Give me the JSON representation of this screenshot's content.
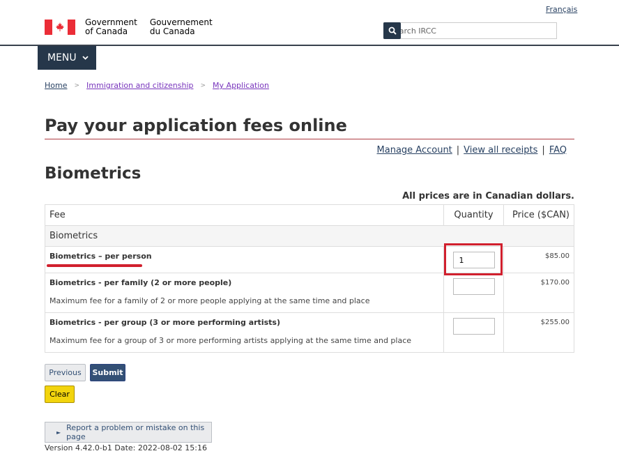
{
  "header": {
    "lang_toggle": "Français",
    "brand_en_line1": "Government",
    "brand_en_line2": "of Canada",
    "brand_fr_line1": "Gouvernement",
    "brand_fr_line2": "du Canada",
    "search_placeholder": "Search IRCC",
    "menu_label": "MENU",
    "colors": {
      "flag_red": "#eb2d37",
      "nav_dark": "#26374a"
    }
  },
  "breadcrumb": [
    "Home",
    "Immigration and citizenship",
    "My Application"
  ],
  "page_title": "Pay your application fees online",
  "account_links": {
    "manage": "Manage Account",
    "receipts": "View all receipts",
    "faq": "FAQ"
  },
  "section_title": "Biometrics",
  "prices_note": "All prices are in Canadian dollars.",
  "table": {
    "headers": {
      "fee": "Fee",
      "quantity": "Quantity",
      "price": "Price ($CAN)"
    },
    "group_label": "Biometrics",
    "rows": [
      {
        "name": "Biometrics – per person",
        "description": "",
        "quantity": "1",
        "price": "$85.00"
      },
      {
        "name": "Biometrics - per family (2 or more people)",
        "description": "Maximum fee for a family of 2 or more people applying at the same time and place",
        "quantity": "",
        "price": "$170.00"
      },
      {
        "name": "Biometrics - per group (3 or more performing artists)",
        "description": "Maximum fee for a group of 3 or more performing artists applying at the same time and place",
        "quantity": "",
        "price": "$255.00"
      }
    ]
  },
  "buttons": {
    "previous": "Previous",
    "submit": "Submit",
    "clear": "Clear"
  },
  "report_label": "Report a problem or mistake on this page",
  "version_text": "Version 4.42.0-b1 Date: 2022-08-02 15:16"
}
